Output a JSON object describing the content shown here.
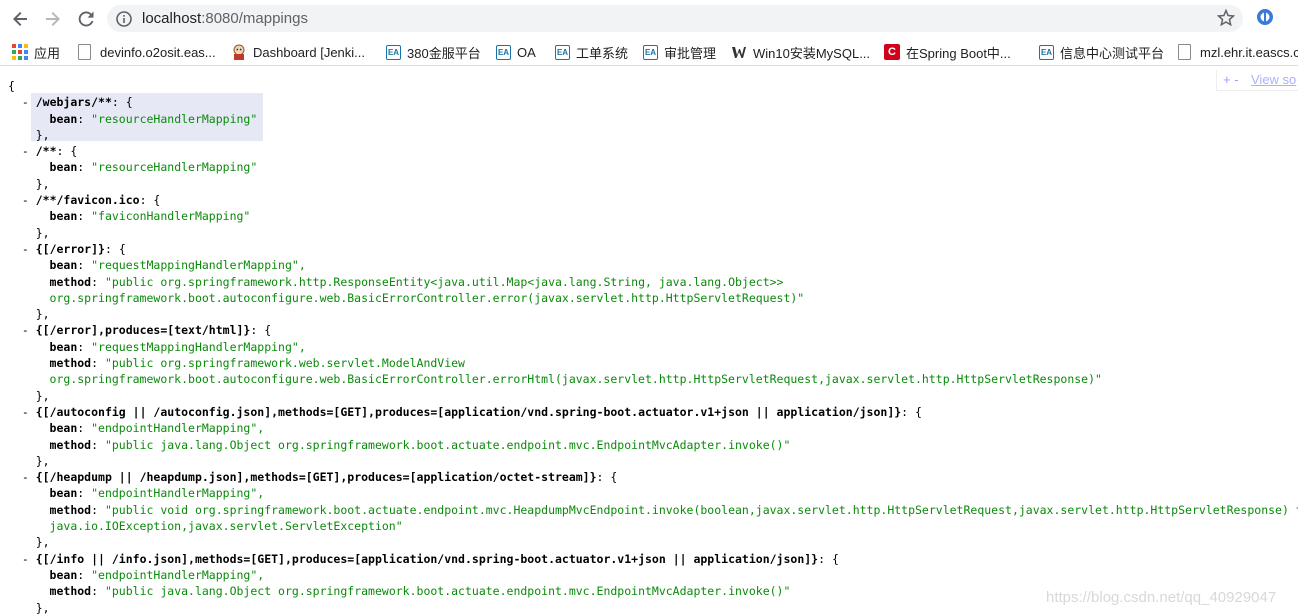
{
  "browser": {
    "url_host": "localhost",
    "url_rest": ":8080/mappings",
    "back_icon": "arrow-left-icon",
    "forward_icon": "arrow-right-icon",
    "reload_icon": "reload-icon",
    "bookmark_star_icon": "star-icon"
  },
  "bookmarks": [
    {
      "label": "应用",
      "icon": "apps-grid-icon"
    },
    {
      "label": "devinfo.o2osit.eas...",
      "icon": "page-icon"
    },
    {
      "label": "Dashboard [Jenki...",
      "icon": "jenkins-icon"
    },
    {
      "label": "380金服平台",
      "icon": "ea-icon"
    },
    {
      "label": "OA",
      "icon": "ea-icon"
    },
    {
      "label": "工单系统",
      "icon": "ea-icon"
    },
    {
      "label": "审批管理",
      "icon": "ea-icon"
    },
    {
      "label": "Win10安装MySQL...",
      "icon": "w-icon"
    },
    {
      "label": "在Spring Boot中...",
      "icon": "csdn-icon"
    },
    {
      "label": "信息中心测试平台",
      "icon": "ea-icon"
    },
    {
      "label": "mzl.ehr.it.eascs.co",
      "icon": "page-icon"
    }
  ],
  "viewer_tools": {
    "collapse": "+ -",
    "view_source": "View so"
  },
  "json_lines": [
    {
      "indent": 0,
      "collapser": "",
      "key": "",
      "text": "{"
    },
    {
      "indent": 1,
      "collapser": "- ",
      "key": "/webjars/**",
      "text": ": {"
    },
    {
      "indent": 2,
      "collapser": "",
      "key": "bean",
      "text": ": ",
      "str": "\"resourceHandlerMapping\""
    },
    {
      "indent": 1,
      "collapser": "",
      "key": "",
      "text": "},"
    },
    {
      "indent": 1,
      "collapser": "- ",
      "key": "/**",
      "text": ": {"
    },
    {
      "indent": 2,
      "collapser": "",
      "key": "bean",
      "text": ": ",
      "str": "\"resourceHandlerMapping\""
    },
    {
      "indent": 1,
      "collapser": "",
      "key": "",
      "text": "},"
    },
    {
      "indent": 1,
      "collapser": "- ",
      "key": "/**/favicon.ico",
      "text": ": {"
    },
    {
      "indent": 2,
      "collapser": "",
      "key": "bean",
      "text": ": ",
      "str": "\"faviconHandlerMapping\""
    },
    {
      "indent": 1,
      "collapser": "",
      "key": "",
      "text": "},"
    },
    {
      "indent": 1,
      "collapser": "- ",
      "key": "{[/error]}",
      "text": ": {"
    },
    {
      "indent": 2,
      "collapser": "",
      "key": "bean",
      "text": ": ",
      "str": "\"requestMappingHandlerMapping\","
    },
    {
      "indent": 2,
      "collapser": "",
      "key": "method",
      "text": ": ",
      "str": "\"public org.springframework.http.ResponseEntity<java.util.Map<java.lang.String, java.lang.Object>>"
    },
    {
      "indent": 2,
      "collapser": "",
      "key": "",
      "text": "",
      "str": "org.springframework.boot.autoconfigure.web.BasicErrorController.error(javax.servlet.http.HttpServletRequest)\""
    },
    {
      "indent": 1,
      "collapser": "",
      "key": "",
      "text": "},"
    },
    {
      "indent": 1,
      "collapser": "- ",
      "key": "{[/error],produces=[text/html]}",
      "text": ": {"
    },
    {
      "indent": 2,
      "collapser": "",
      "key": "bean",
      "text": ": ",
      "str": "\"requestMappingHandlerMapping\","
    },
    {
      "indent": 2,
      "collapser": "",
      "key": "method",
      "text": ": ",
      "str": "\"public org.springframework.web.servlet.ModelAndView"
    },
    {
      "indent": 2,
      "collapser": "",
      "key": "",
      "text": "",
      "str": "org.springframework.boot.autoconfigure.web.BasicErrorController.errorHtml(javax.servlet.http.HttpServletRequest,javax.servlet.http.HttpServletResponse)\""
    },
    {
      "indent": 1,
      "collapser": "",
      "key": "",
      "text": "},"
    },
    {
      "indent": 1,
      "collapser": "- ",
      "key": "{[/autoconfig || /autoconfig.json],methods=[GET],produces=[application/vnd.spring-boot.actuator.v1+json || application/json]}",
      "text": ": {"
    },
    {
      "indent": 2,
      "collapser": "",
      "key": "bean",
      "text": ": ",
      "str": "\"endpointHandlerMapping\","
    },
    {
      "indent": 2,
      "collapser": "",
      "key": "method",
      "text": ": ",
      "str": "\"public java.lang.Object org.springframework.boot.actuate.endpoint.mvc.EndpointMvcAdapter.invoke()\""
    },
    {
      "indent": 1,
      "collapser": "",
      "key": "",
      "text": "},"
    },
    {
      "indent": 1,
      "collapser": "- ",
      "key": "{[/heapdump || /heapdump.json],methods=[GET],produces=[application/octet-stream]}",
      "text": ": {"
    },
    {
      "indent": 2,
      "collapser": "",
      "key": "bean",
      "text": ": ",
      "str": "\"endpointHandlerMapping\","
    },
    {
      "indent": 2,
      "collapser": "",
      "key": "method",
      "text": ": ",
      "str": "\"public void org.springframework.boot.actuate.endpoint.mvc.HeapdumpMvcEndpoint.invoke(boolean,javax.servlet.http.HttpServletRequest,javax.servlet.http.HttpServletResponse) throws"
    },
    {
      "indent": 2,
      "collapser": "",
      "key": "",
      "text": "",
      "str": "java.io.IOException,javax.servlet.ServletException\""
    },
    {
      "indent": 1,
      "collapser": "",
      "key": "",
      "text": "},"
    },
    {
      "indent": 1,
      "collapser": "- ",
      "key": "{[/info || /info.json],methods=[GET],produces=[application/vnd.spring-boot.actuator.v1+json || application/json]}",
      "text": ": {"
    },
    {
      "indent": 2,
      "collapser": "",
      "key": "bean",
      "text": ": ",
      "str": "\"endpointHandlerMapping\","
    },
    {
      "indent": 2,
      "collapser": "",
      "key": "method",
      "text": ": ",
      "str": "\"public java.lang.Object org.springframework.boot.actuate.endpoint.mvc.EndpointMvcAdapter.invoke()\""
    },
    {
      "indent": 1,
      "collapser": "",
      "key": "",
      "text": "},"
    }
  ],
  "watermark": "https://blog.csdn.net/qq_40929047",
  "colors": {
    "string": "#0b8a0b",
    "highlight": "#e6e9f5"
  }
}
